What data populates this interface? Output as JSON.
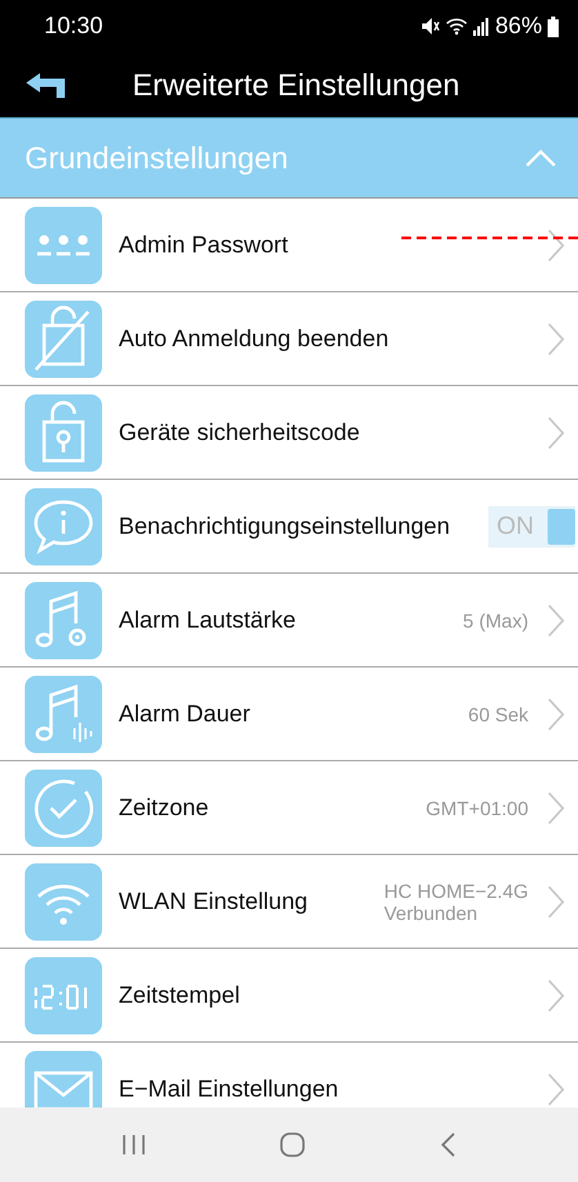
{
  "status_bar": {
    "time": "10:30",
    "battery": "86%"
  },
  "header": {
    "title": "Erweiterte Einstellungen"
  },
  "section": {
    "title": "Grundeinstellungen",
    "expanded": true
  },
  "rows": [
    {
      "kind": "link",
      "label": "Admin Passwort"
    },
    {
      "kind": "link",
      "label": "Auto Anmeldung beenden"
    },
    {
      "kind": "link",
      "label": "Geräte sicherheitscode"
    },
    {
      "kind": "toggle",
      "label": "Benachrichtigungseinstellungen",
      "on": true,
      "toggle_text": "ON"
    },
    {
      "kind": "link",
      "label": "Alarm Lautstärke",
      "value": [
        "5 (Max)"
      ]
    },
    {
      "kind": "link",
      "label": "Alarm Dauer",
      "value": [
        "60 Sek"
      ]
    },
    {
      "kind": "link",
      "label": "Zeitzone",
      "value": [
        "GMT+01:00"
      ]
    },
    {
      "kind": "link",
      "label": "WLAN Einstellung",
      "value": [
        "HC HOME−2.4G",
        "Verbunden"
      ]
    },
    {
      "kind": "link",
      "label": "Zeitstempel"
    },
    {
      "kind": "link",
      "label": "E−Mail Einstellungen"
    }
  ]
}
